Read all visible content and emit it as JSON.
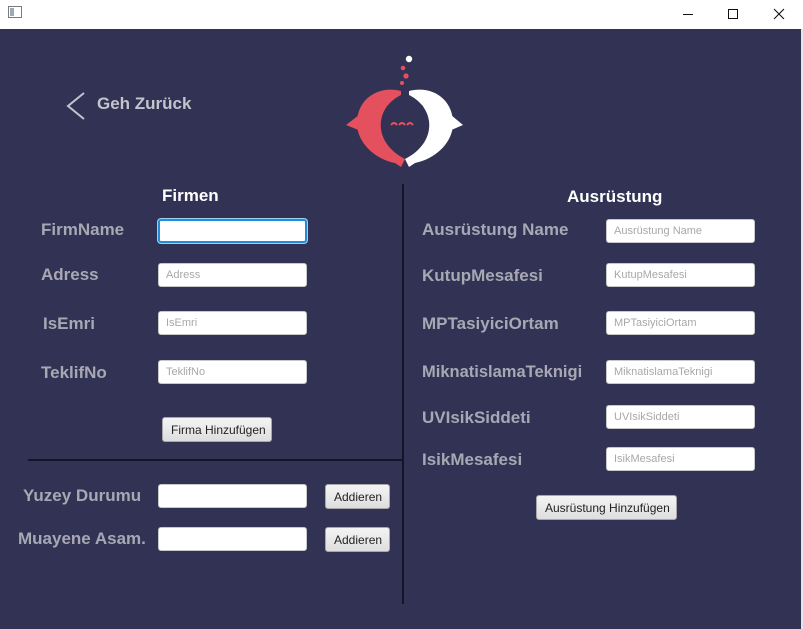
{
  "window": {
    "icons": {
      "app": "app-icon",
      "minimize": "minimize-icon",
      "maximize": "maximize-icon",
      "close": "close-icon"
    }
  },
  "back": {
    "label": "Geh Zurück",
    "icon": "chevron-left-icon"
  },
  "logo": {
    "icon": "fish-logo-icon",
    "colors": {
      "left_fish": "#e5505e",
      "right_fish": "#ffffff"
    }
  },
  "firmen": {
    "title": "Firmen",
    "fields": [
      {
        "label": "FirmName",
        "value": "",
        "placeholder": ""
      },
      {
        "label": "Adress",
        "value": "",
        "placeholder": "Adress"
      },
      {
        "label": "IsEmri",
        "value": "",
        "placeholder": "IsEmri"
      },
      {
        "label": "TeklifNo",
        "value": "",
        "placeholder": "TeklifNo"
      }
    ],
    "add_button": "Firma Hinzufügen"
  },
  "extras": {
    "rows": [
      {
        "label": "Yuzey Durumu",
        "value": "",
        "button": "Addieren"
      },
      {
        "label": "Muayene Asam.",
        "value": "",
        "button": "Addieren"
      }
    ]
  },
  "ausruestung": {
    "title": "Ausrüstung",
    "fields": [
      {
        "label": "Ausrüstung Name",
        "value": "",
        "placeholder": "Ausrüstung Name"
      },
      {
        "label": "KutupMesafesi",
        "value": "",
        "placeholder": "KutupMesafesi"
      },
      {
        "label": "MPTasiyiciOrtam",
        "value": "",
        "placeholder": "MPTasiyiciOrtam"
      },
      {
        "label": "MiknatislamaTeknigi",
        "value": "",
        "placeholder": "MiknatislamaTeknigi"
      },
      {
        "label": "UVIsikSiddeti",
        "value": "",
        "placeholder": "UVIsikSiddeti"
      },
      {
        "label": "IsikMesafesi",
        "value": "",
        "placeholder": "IsikMesafesi"
      }
    ],
    "add_button": "Ausrüstung Hinzufügen"
  },
  "colors": {
    "background": "#323255",
    "focus": "#1e8fd8",
    "label": "#a8a8b4",
    "title": "#ffffff"
  }
}
